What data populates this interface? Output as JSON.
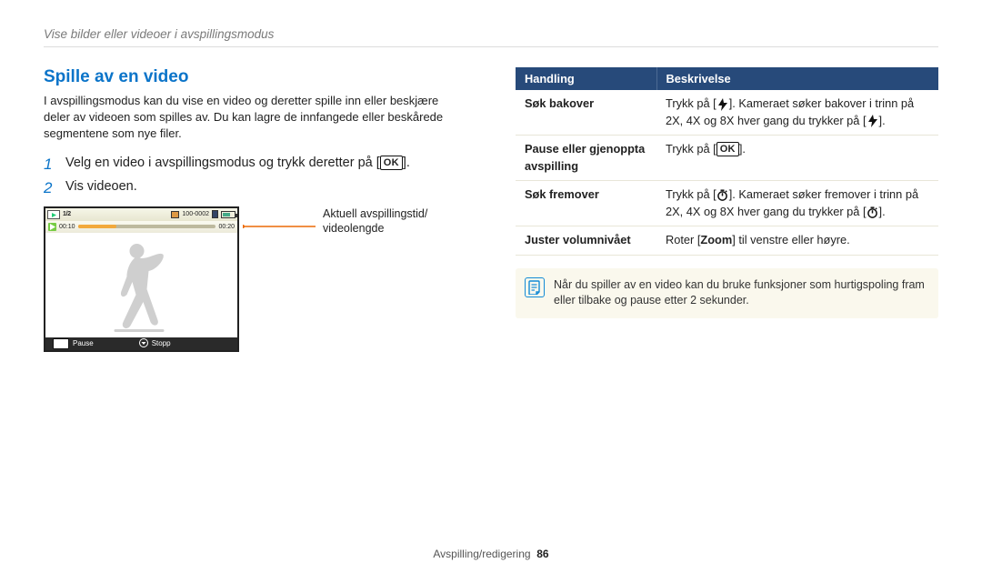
{
  "breadcrumb": "Vise bilder eller videoer i avspillingsmodus",
  "section_title": "Spille av en video",
  "intro": "I avspillingsmodus kan du vise en video og deretter spille inn eller beskjære deler av videoen som spilles av. Du kan lagre de innfangede eller beskårede segmentene som nye filer.",
  "steps": {
    "s1_num": "1",
    "s1_pre": "Velg en video i avspillingsmodus og trykk deretter på [",
    "s1_post": "].",
    "s2_num": "2",
    "s2": "Vis videoen."
  },
  "ok_label": "OK",
  "screen": {
    "counter": "1/2",
    "card": "100-0002",
    "t_cur": "00:10",
    "t_total": "00:20",
    "pause": "Pause",
    "stop": "Stopp"
  },
  "pointer_caption": "Aktuell avspillingstid/\nvideolengde",
  "table": {
    "h1": "Handling",
    "h2": "Beskrivelse",
    "r1_label": "Søk bakover",
    "r1_a": "Trykk på [",
    "r1_b": "]. Kameraet søker bakover i trinn på 2X, 4X og 8X hver gang du trykker på [",
    "r1_c": "].",
    "r2_label": "Pause eller gjenoppta avspilling",
    "r2_a": "Trykk på [",
    "r2_b": "].",
    "r3_label": "Søk fremover",
    "r3_a": "Trykk på [",
    "r3_b": "]. Kameraet søker fremover i trinn på 2X, 4X og 8X hver gang du trykker på [",
    "r3_c": "].",
    "r4_label": "Juster volumnivået",
    "r4_a": "Roter [",
    "r4_zoom": "Zoom",
    "r4_b": "] til venstre eller høyre."
  },
  "note": "Når du spiller av en video kan du bruke funksjoner som hurtigspoling fram eller tilbake og pause etter 2 sekunder.",
  "footer_label": "Avspilling/redigering",
  "footer_page": "86"
}
